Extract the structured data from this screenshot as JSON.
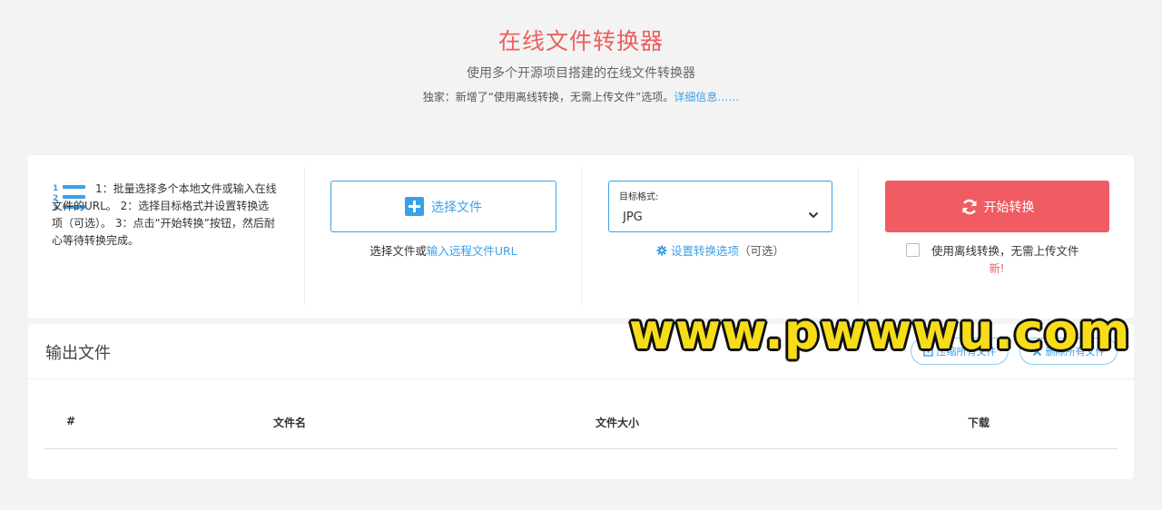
{
  "header": {
    "title": "在线文件转换器",
    "subtitle": "使用多个开源项目搭建的在线文件转换器",
    "notice_text": "独家：新增了“使用离线转换，无需上传文件”选项。",
    "notice_link": "详细信息……"
  },
  "steps": {
    "text": "1：批量选择多个本地文件或输入在线文件的URL。 2：选择目标格式并设置转换选项（可选）。 3：点击“开始转换”按钮，然后耐心等待转换完成。"
  },
  "select": {
    "button_label": "选择文件",
    "hint_prefix": "选择文件或",
    "hint_link": "输入远程文件URL"
  },
  "format": {
    "label": "目标格式:",
    "value": "JPG",
    "options_link": "设置转换选项",
    "options_suffix": "（可选）"
  },
  "convert": {
    "button_label": "开始转换",
    "offline_label": "使用离线转换，无需上传文件",
    "offline_checked": false,
    "new_badge": "新!"
  },
  "output": {
    "title": "输出文件",
    "pack_button": "压缩所有文件",
    "delete_button": "删除所有文件",
    "columns": [
      "#",
      "文件名",
      "文件大小",
      "下载"
    ]
  },
  "watermark": "www.pwwwu.com",
  "colors": {
    "accent_blue": "#3aa0e8",
    "accent_red": "#f15b63",
    "title_red": "#ec5f5f"
  }
}
